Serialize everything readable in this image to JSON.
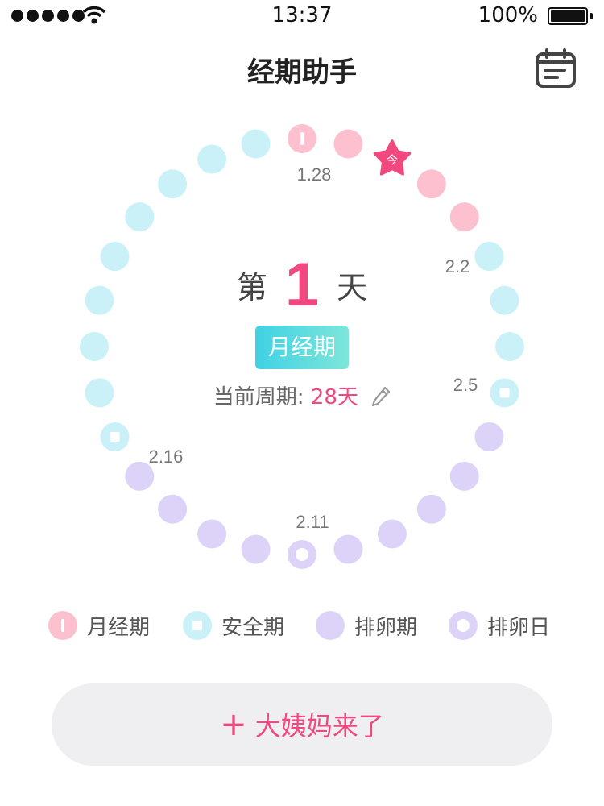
{
  "status_bar": {
    "time": "13:37",
    "battery": "100%"
  },
  "header": {
    "title": "经期助手"
  },
  "icons": {
    "calendar": "calendar-icon",
    "edit": "pencil-icon",
    "today": "star-icon"
  },
  "cycle": {
    "day_prefix": "第",
    "day_number": "1",
    "day_suffix": "天",
    "phase": "月经期",
    "cycle_label": "当前周期:",
    "cycle_length": "28天",
    "today_label": "今",
    "date_labels": [
      "1.28",
      "2.2",
      "2.5",
      "2.11",
      "2.16"
    ],
    "days": [
      "period",
      "period",
      "period",
      "period",
      "period",
      "safe",
      "safe",
      "safe",
      "safe",
      "ovulation",
      "ovulation",
      "ovulation",
      "ovulation",
      "ovulation",
      "ovulation-day",
      "ovulation",
      "ovulation",
      "ovulation",
      "ovulation",
      "safe",
      "safe",
      "safe",
      "safe",
      "safe",
      "safe",
      "safe",
      "safe",
      "safe"
    ]
  },
  "legend": [
    {
      "key": "period",
      "label": "月经期"
    },
    {
      "key": "safe",
      "label": "安全期"
    },
    {
      "key": "ovulation",
      "label": "排卵期"
    },
    {
      "key": "ovulation-day",
      "label": "排卵日"
    }
  ],
  "colors": {
    "period": "#fcc0cf",
    "safe": "#c9f1f7",
    "ovulation": "#ddd3f8",
    "accent": "#f0487f",
    "badge_start": "#40d1e4",
    "badge_end": "#7ee6d9"
  },
  "action": {
    "label": "大姨妈来了"
  }
}
